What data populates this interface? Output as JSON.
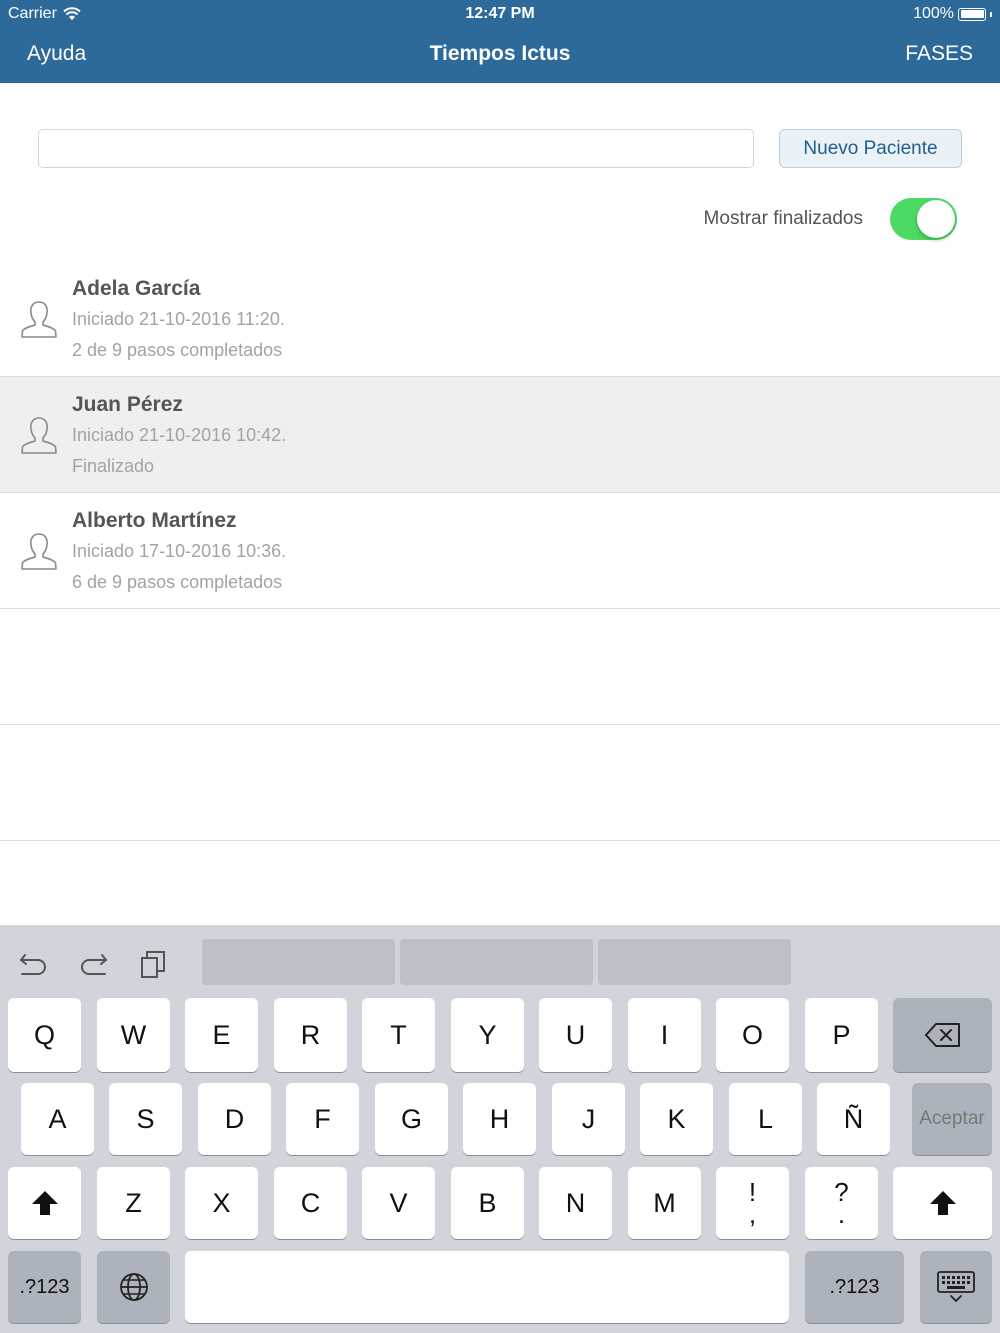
{
  "status": {
    "carrier": "Carrier",
    "time": "12:47 PM",
    "battery": "100%"
  },
  "nav": {
    "left": "Ayuda",
    "title": "Tiempos Ictus",
    "right": "FASES"
  },
  "search": {
    "value": "",
    "placeholder": ""
  },
  "new_patient": "Nuevo Paciente",
  "toggle": {
    "label": "Mostrar finalizados",
    "on": true
  },
  "patients": [
    {
      "name": "Adela García",
      "started": "Iniciado 21-10-2016 11:20.",
      "status": "2 de 9 pasos completados",
      "selected": false
    },
    {
      "name": "Juan Pérez",
      "started": "Iniciado 21-10-2016 10:42.",
      "status": "Finalizado",
      "selected": true
    },
    {
      "name": "Alberto Martínez",
      "started": "Iniciado 17-10-2016 10:36.",
      "status": "6 de 9 pasos completados",
      "selected": false
    }
  ],
  "keyboard": {
    "tools": [
      "undo-icon",
      "redo-icon",
      "paste-icon"
    ],
    "row1": [
      "Q",
      "W",
      "E",
      "R",
      "T",
      "Y",
      "U",
      "I",
      "O",
      "P"
    ],
    "row2": [
      "A",
      "S",
      "D",
      "F",
      "G",
      "H",
      "J",
      "K",
      "L",
      "Ñ"
    ],
    "row3": [
      "Z",
      "X",
      "C",
      "V",
      "B",
      "N",
      "M"
    ],
    "punct1": {
      "top": "!",
      "bottom": ","
    },
    "punct2": {
      "top": "?",
      "bottom": "."
    },
    "accept": "Aceptar",
    "numbers": ".?123"
  }
}
